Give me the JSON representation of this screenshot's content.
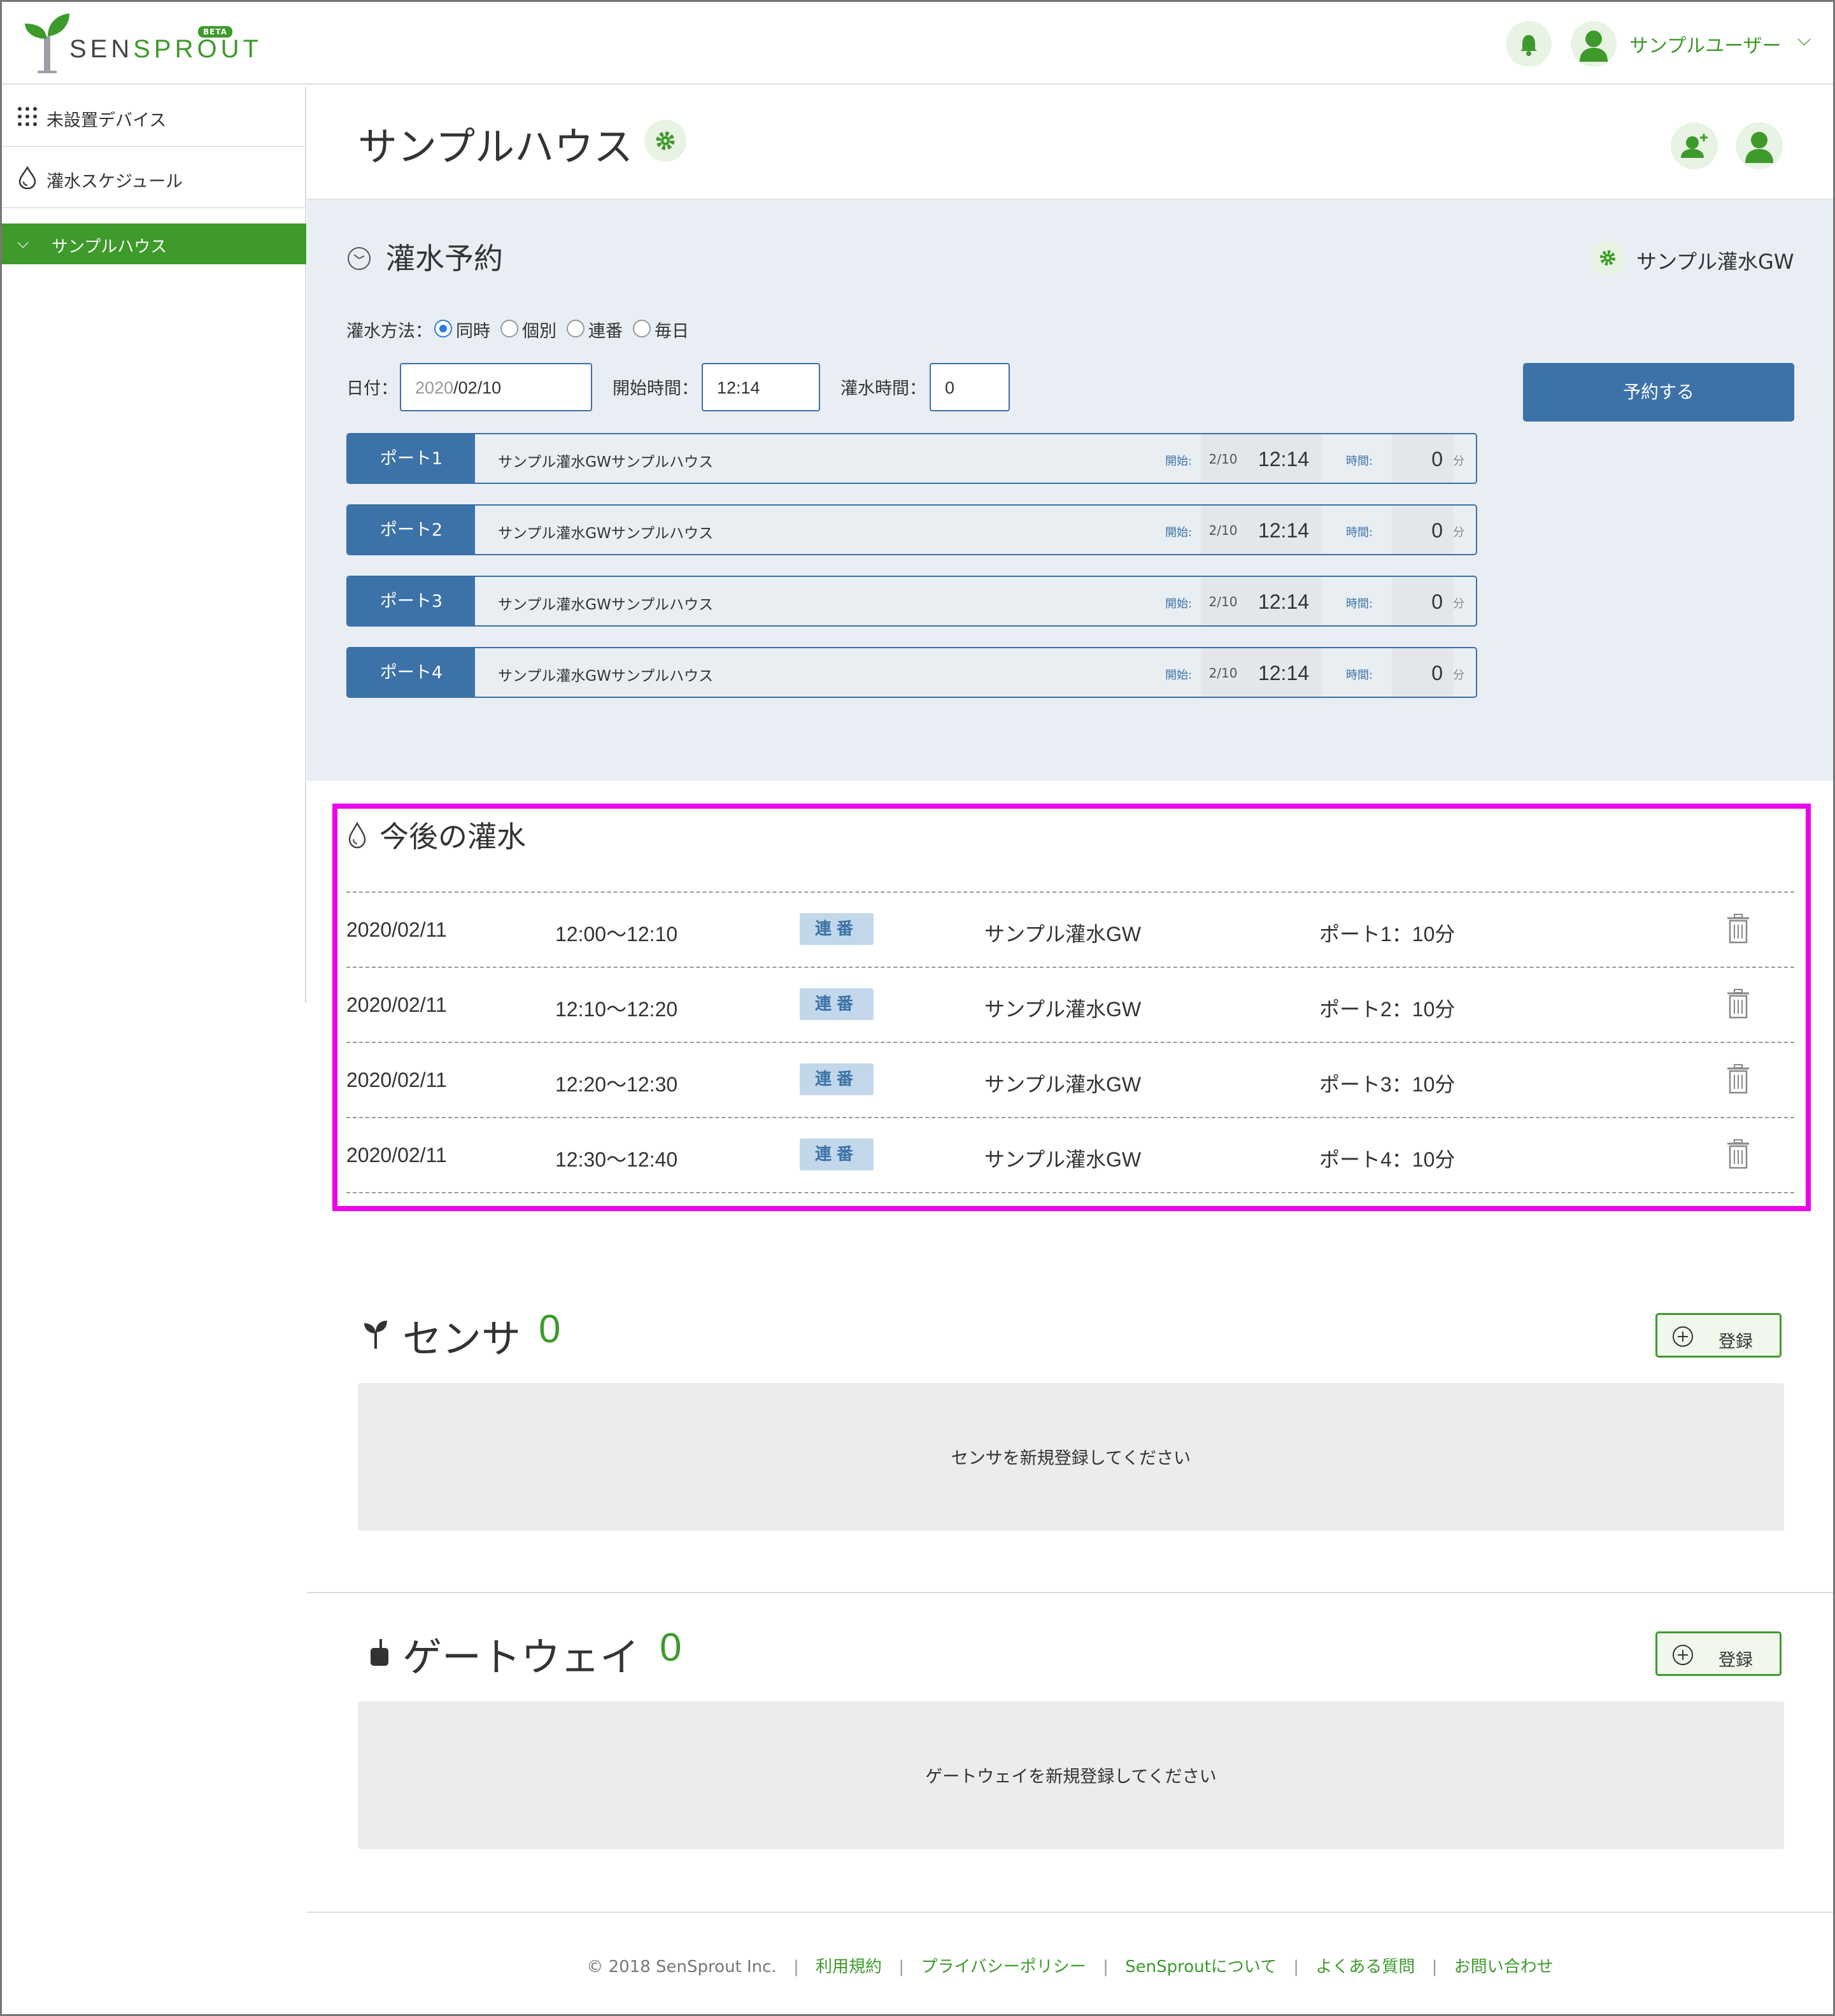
{
  "brand": {
    "name_prefix": "SEN",
    "name_suffix": "SPROUT",
    "badge": "BETA"
  },
  "header": {
    "user_name": "サンプルユーザー",
    "user_chevron": "⌵"
  },
  "sidebar": {
    "items": [
      {
        "label": "未設置デバイス",
        "icon": "grid-icon"
      },
      {
        "label": "灌水スケジュール",
        "icon": "droplet-icon"
      }
    ],
    "active": {
      "label": "サンプルハウス",
      "chevron": "⌵"
    }
  },
  "page": {
    "title": "サンプルハウス"
  },
  "reservation": {
    "title": "灌水予約",
    "gateway_name": "サンプル灌水GW",
    "method_label": "灌水方法：",
    "methods": [
      "同時",
      "個別",
      "連番",
      "毎日"
    ],
    "selected_method": "同時",
    "date_label": "日付：",
    "date_year": "2020",
    "date_rest": "/02/10",
    "start_label": "開始時間：",
    "start_value": "12:14",
    "duration_label": "灌水時間：",
    "duration_value": "0",
    "submit_label": "予約する",
    "ports": [
      {
        "name": "ポート1",
        "desc": "サンプル灌水GWサンプルハウス",
        "start_label": "開始:",
        "date": "2/10",
        "time": "12:14",
        "duration_label": "時間:",
        "minutes": "0",
        "unit": "分"
      },
      {
        "name": "ポート2",
        "desc": "サンプル灌水GWサンプルハウス",
        "start_label": "開始:",
        "date": "2/10",
        "time": "12:14",
        "duration_label": "時間:",
        "minutes": "0",
        "unit": "分"
      },
      {
        "name": "ポート3",
        "desc": "サンプル灌水GWサンプルハウス",
        "start_label": "開始:",
        "date": "2/10",
        "time": "12:14",
        "duration_label": "時間:",
        "minutes": "0",
        "unit": "分"
      },
      {
        "name": "ポート4",
        "desc": "サンプル灌水GWサンプルハウス",
        "start_label": "開始:",
        "date": "2/10",
        "time": "12:14",
        "duration_label": "時間:",
        "minutes": "0",
        "unit": "分"
      }
    ]
  },
  "upcoming": {
    "title": "今後の灌水",
    "rows": [
      {
        "date": "2020/02/11",
        "time": "12:00〜12:10",
        "mode": "連番",
        "gateway": "サンプル灌水GW",
        "port": "ポート1：10分"
      },
      {
        "date": "2020/02/11",
        "time": "12:10〜12:20",
        "mode": "連番",
        "gateway": "サンプル灌水GW",
        "port": "ポート2：10分"
      },
      {
        "date": "2020/02/11",
        "time": "12:20〜12:30",
        "mode": "連番",
        "gateway": "サンプル灌水GW",
        "port": "ポート3：10分"
      },
      {
        "date": "2020/02/11",
        "time": "12:30〜12:40",
        "mode": "連番",
        "gateway": "サンプル灌水GW",
        "port": "ポート4：10分"
      }
    ]
  },
  "sensors": {
    "title": "センサ",
    "count": "0",
    "register_label": "登録",
    "empty_message": "センサを新規登録してください"
  },
  "gateways": {
    "title": "ゲートウェイ",
    "count": "0",
    "register_label": "登録",
    "empty_message": "ゲートウェイを新規登録してください"
  },
  "footer": {
    "copyright": "© 2018 SenSprout Inc.",
    "separator": "|",
    "links": [
      "利用規約",
      "プライバシーポリシー",
      "SenSproutについて",
      "よくある質問",
      "お問い合わせ"
    ]
  },
  "colors": {
    "brand_green": "#3d9a2b",
    "accent_blue": "#3c72a8",
    "highlight": "#ec00ec",
    "panel_bg": "#e8eef4"
  }
}
